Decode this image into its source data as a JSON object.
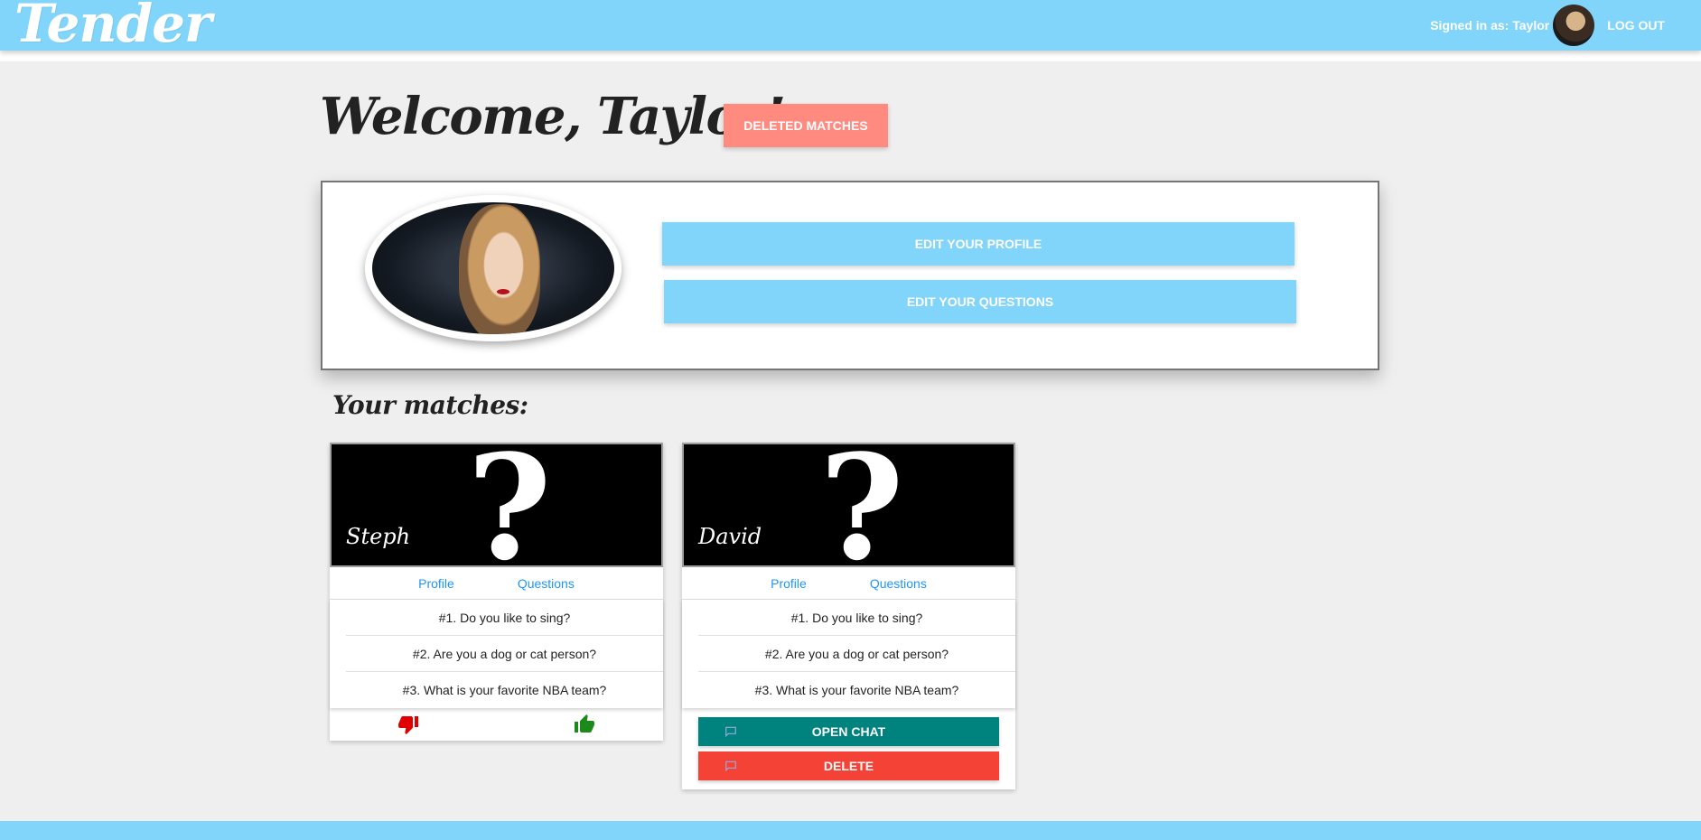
{
  "navbar": {
    "brand": "Tender",
    "signed_in": "Signed in as: Taylor",
    "logout": "LOG OUT"
  },
  "welcome": {
    "title": "Welcome, Taylor!",
    "deleted_matches": "DELETED MATCHES"
  },
  "profile": {
    "edit_profile": "EDIT YOUR PROFILE",
    "edit_questions": "EDIT YOUR QUESTIONS"
  },
  "matches": {
    "title": "Your matches:",
    "items": [
      {
        "name": "Steph",
        "profile_link": "Profile",
        "questions_link": "Questions",
        "questions": [
          "#1. Do you like to sing?",
          "#2. Are you a dog or cat person?",
          "#3. What is your favorite NBA team?"
        ]
      },
      {
        "name": "David",
        "profile_link": "Profile",
        "questions_link": "Questions",
        "questions": [
          "#1. Do you like to sing?",
          "#2. Are you a dog or cat person?",
          "#3. What is your favorite NBA team?"
        ],
        "open_chat": "OPEN CHAT",
        "delete": "DELETE"
      }
    ]
  },
  "colors": {
    "nav": "#81d4fa",
    "deleted_btn": "#ff8a80",
    "open_chat": "#00827f",
    "delete": "#f44336",
    "link": "#2196f3",
    "thumb_down": "#e00000",
    "thumb_up": "#1b8a1b"
  },
  "icons": [
    "thumbs-down-icon",
    "thumbs-up-icon",
    "chat-icon"
  ]
}
